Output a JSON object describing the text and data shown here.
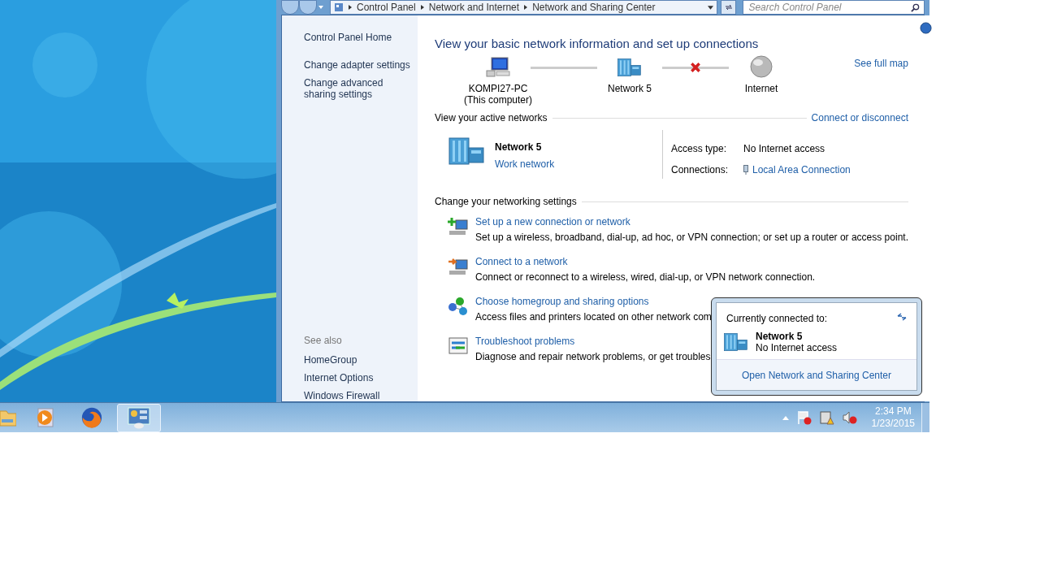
{
  "window": {
    "breadcrumb": [
      "Control Panel",
      "Network and Internet",
      "Network and Sharing Center"
    ],
    "search": {
      "placeholder": "Search Control Panel"
    },
    "sidebar": {
      "links": [
        "Control Panel Home",
        "Change adapter settings",
        "Change advanced sharing settings"
      ],
      "see_also_title": "See also",
      "see_also": [
        "HomeGroup",
        "Internet Options",
        "Windows Firewall"
      ]
    },
    "main": {
      "title": "View your basic network information and set up connections",
      "map": {
        "nodes": [
          {
            "kind": "computer",
            "label": "KOMPI27-PC",
            "sublabel": "(This computer)"
          },
          {
            "kind": "network",
            "label": "Network 5"
          },
          {
            "kind": "internet",
            "label": "Internet"
          }
        ],
        "links": [
          {
            "broken": false
          },
          {
            "broken": true
          }
        ],
        "see_full_map": "See full map"
      },
      "active_networks": {
        "heading": "View your active networks",
        "action": "Connect or disconnect",
        "name": "Network 5",
        "type": "Work network",
        "access_type_label": "Access type:",
        "access_type": "No Internet access",
        "connections_label": "Connections:",
        "connection": "Local Area Connection"
      },
      "settings": {
        "heading": "Change your networking settings",
        "tasks": [
          {
            "kind": "new-connection",
            "title": "Set up a new connection or network",
            "description": "Set up a wireless, broadband, dial-up, ad hoc, or VPN connection; or set up a router or access point."
          },
          {
            "kind": "connect",
            "title": "Connect to a network",
            "description": "Connect or reconnect to a wireless, wired, dial-up, or VPN network connection."
          },
          {
            "kind": "homegroup",
            "title": "Choose homegroup and sharing options",
            "description": "Access files and printers located on other network com"
          },
          {
            "kind": "troubleshoot",
            "title": "Troubleshoot problems",
            "description": "Diagnose and repair network problems, or get troubles"
          }
        ]
      }
    }
  },
  "popup": {
    "heading": "Currently connected to:",
    "network": "Network 5",
    "status": "No Internet access",
    "link": "Open Network and Sharing Center"
  },
  "taskbar": {
    "apps": [
      {
        "kind": "folder",
        "selected": false
      },
      {
        "kind": "media",
        "selected": false
      },
      {
        "kind": "browser",
        "selected": false
      },
      {
        "kind": "control-panel",
        "selected": true
      }
    ],
    "tray": [
      {
        "kind": "arrow"
      },
      {
        "kind": "flag-error"
      },
      {
        "kind": "network-warning"
      },
      {
        "kind": "speaker-muted"
      }
    ],
    "time": "2:34 PM",
    "date": "1/23/2015"
  }
}
